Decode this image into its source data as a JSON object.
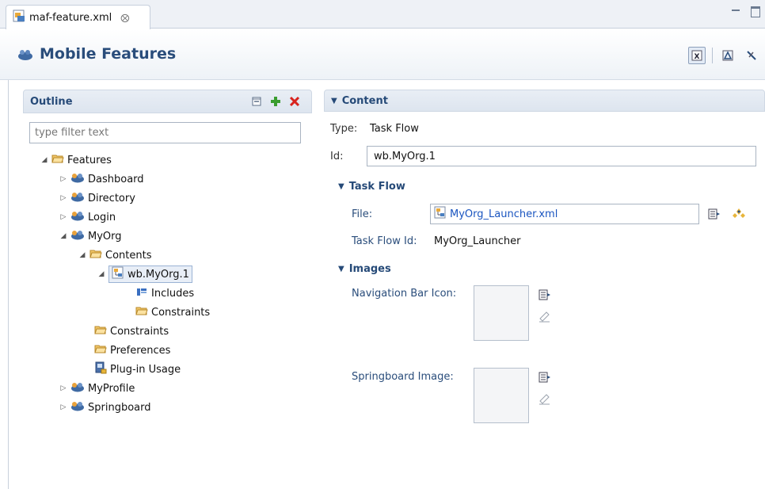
{
  "tab": {
    "label": "maf-feature.xml",
    "close_glyph": "⨂"
  },
  "header": {
    "title": "Mobile Features"
  },
  "outline": {
    "title": "Outline",
    "filter_placeholder": "type filter text",
    "tree": [
      {
        "label": "Features",
        "icon": "folder-open-icon",
        "expanded": true
      },
      {
        "label": "Dashboard",
        "icon": "feature-icon",
        "expanded": false
      },
      {
        "label": "Directory",
        "icon": "feature-icon",
        "expanded": false
      },
      {
        "label": "Login",
        "icon": "feature-icon",
        "expanded": false
      },
      {
        "label": "MyOrg",
        "icon": "feature-icon",
        "expanded": true
      },
      {
        "label": "Contents",
        "icon": "folder-open-icon",
        "expanded": true
      },
      {
        "label": "wb.MyOrg.1",
        "icon": "taskflow-icon",
        "expanded": true,
        "selected": true
      },
      {
        "label": "Includes",
        "icon": "includes-icon"
      },
      {
        "label": "Constraints",
        "icon": "folder-open-icon"
      },
      {
        "label": "Constraints",
        "icon": "folder-open-icon"
      },
      {
        "label": "Preferences",
        "icon": "folder-open-icon"
      },
      {
        "label": "Plug-in Usage",
        "icon": "plugin-icon"
      },
      {
        "label": "MyProfile",
        "icon": "feature-icon",
        "expanded": false
      },
      {
        "label": "Springboard",
        "icon": "feature-icon",
        "expanded": false
      }
    ]
  },
  "content": {
    "title": "Content",
    "type_label": "Type:",
    "type_value": "Task Flow",
    "id_label": "Id:",
    "id_value": "wb.MyOrg.1",
    "task_flow": {
      "title": "Task Flow",
      "file_label": "File:",
      "file_value": "MyOrg_Launcher.xml",
      "task_flow_id_label": "Task Flow Id:",
      "task_flow_id_value": "MyOrg_Launcher"
    },
    "images": {
      "title": "Images",
      "nav_bar_icon_label": "Navigation Bar Icon:",
      "springboard_image_label": "Springboard Image:"
    }
  },
  "colors": {
    "accent": "#2a4d7b",
    "link": "#1a55c0",
    "panel_header": "#dde5ef"
  }
}
